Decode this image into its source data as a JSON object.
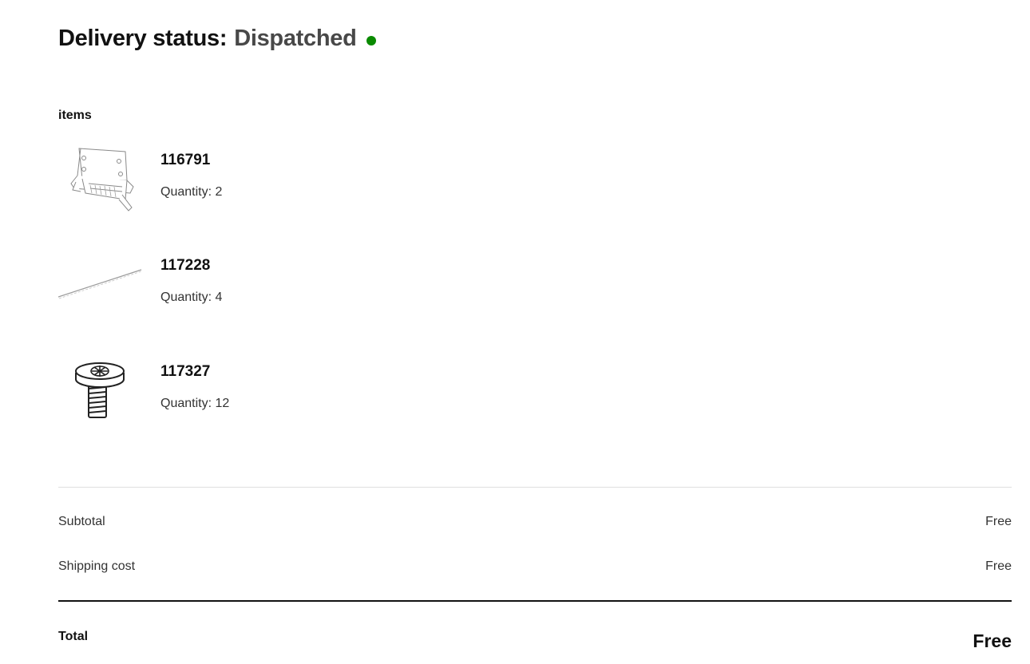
{
  "delivery": {
    "label": "Delivery status:",
    "status": "Dispatched",
    "status_color": "#0a8a00"
  },
  "items_heading": "items",
  "items": [
    {
      "id": "116791",
      "quantity": "Quantity: 2",
      "icon": "bracket-part-icon"
    },
    {
      "id": "117228",
      "quantity": "Quantity: 4",
      "icon": "rod-part-icon"
    },
    {
      "id": "117327",
      "quantity": "Quantity: 12",
      "icon": "screw-part-icon"
    }
  ],
  "summary": {
    "subtotal_label": "Subtotal",
    "subtotal_value": "Free",
    "shipping_label": "Shipping cost",
    "shipping_value": "Free",
    "total_label": "Total",
    "total_value": "Free"
  }
}
